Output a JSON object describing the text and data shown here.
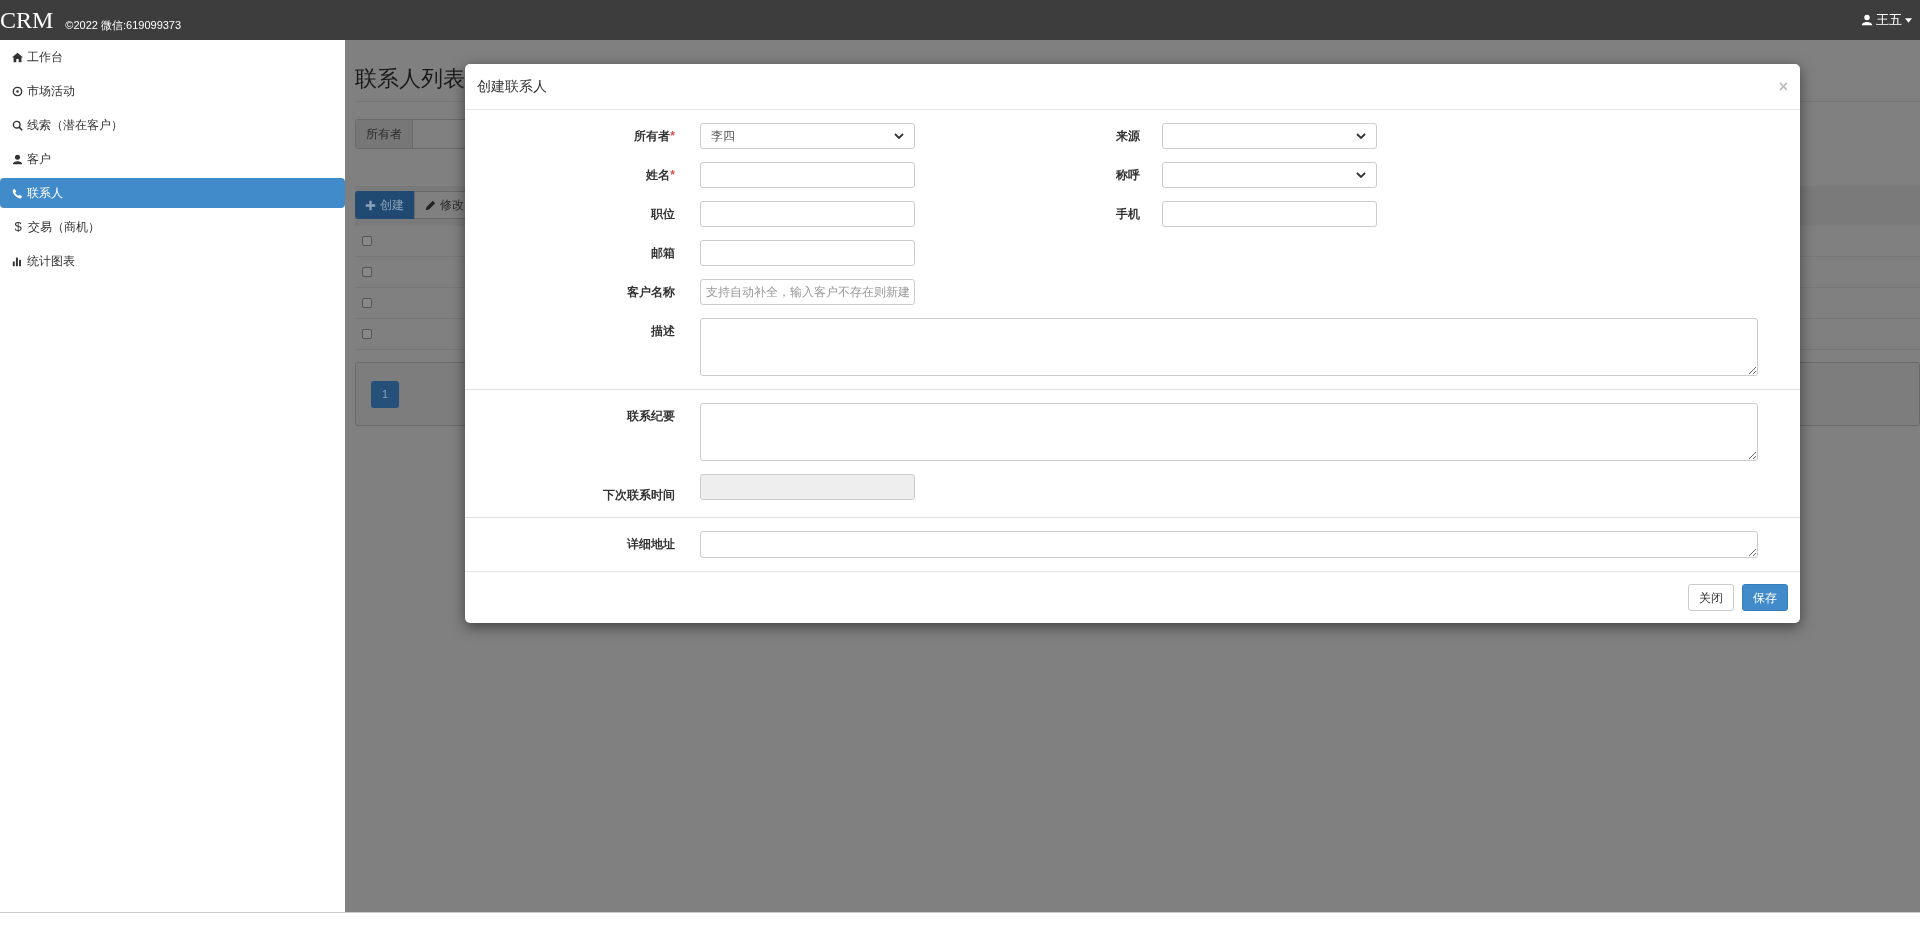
{
  "header": {
    "brand": "CRM",
    "copyright": "©2022 微信:619099373",
    "user": "王五"
  },
  "sidebar": {
    "items": [
      {
        "label": "工作台",
        "kind": "home",
        "selected": false
      },
      {
        "label": "市场活动",
        "kind": "circle",
        "selected": false
      },
      {
        "label": "线索（潜在客户）",
        "kind": "search",
        "selected": false
      },
      {
        "label": "客户",
        "kind": "user",
        "selected": false
      },
      {
        "label": "联系人",
        "kind": "phone",
        "selected": true
      },
      {
        "label": "交易（商机）",
        "kind": "usd",
        "glyph": "$",
        "selected": false
      },
      {
        "label": "统计图表",
        "kind": "chart",
        "selected": false
      }
    ]
  },
  "page": {
    "title": "联系人列表",
    "filter_label": "所有者",
    "toolbar": [
      {
        "label": "创建",
        "kind": "primary"
      },
      {
        "label": "修改",
        "kind": "default"
      }
    ],
    "rows": [
      {
        "checked": false
      },
      {
        "checked": false
      },
      {
        "checked": false
      },
      {
        "checked": false
      }
    ],
    "pagination": [
      "1"
    ]
  },
  "modal": {
    "title": "创建联系人",
    "close": "×",
    "sections": [
      {
        "rows": [
          [
            {
              "label": "所有者",
              "required_mark": "*",
              "kind": "select",
              "value": "李四"
            },
            {
              "label": "来源",
              "kind": "select"
            }
          ],
          [
            {
              "label": "姓名",
              "required_mark": "*",
              "kind": "input"
            },
            {
              "label": "称呼",
              "kind": "select"
            }
          ],
          [
            {
              "label": "职位",
              "kind": "input"
            },
            {
              "label": "手机",
              "kind": "input"
            }
          ],
          [
            {
              "label": "邮箱",
              "kind": "input"
            }
          ],
          [
            {
              "label": "客户名称",
              "kind": "input",
              "placeholder": "支持自动补全，输入客户不存在则新建"
            }
          ],
          [
            {
              "label": "描述",
              "kind": "textarea"
            }
          ]
        ]
      },
      {
        "rows": [
          [
            {
              "label": "联系纪要",
              "kind": "textarea"
            }
          ],
          [
            {
              "label": "下次联系时间",
              "kind": "disabled"
            }
          ]
        ]
      },
      {
        "rows": [
          [
            {
              "label": "详细地址",
              "kind": "address"
            }
          ]
        ]
      }
    ],
    "buttons": [
      {
        "label": "关闭",
        "kind": "default"
      },
      {
        "label": "保存",
        "kind": "primary"
      }
    ]
  }
}
